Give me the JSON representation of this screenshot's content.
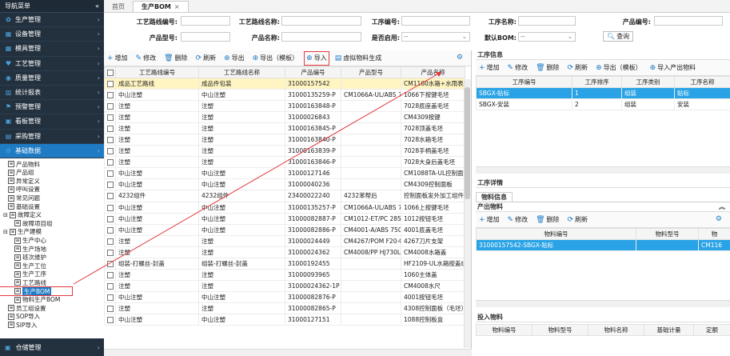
{
  "sidebar": {
    "title": "导航菜单",
    "collapse_icon": "«",
    "menus": [
      {
        "label": "生产管理",
        "icon": "gear-icon"
      },
      {
        "label": "设备管理",
        "icon": "grid-icon"
      },
      {
        "label": "模具管理",
        "icon": "grid-icon"
      },
      {
        "label": "工艺管理",
        "icon": "heart-icon"
      },
      {
        "label": "质量管理",
        "icon": "check-icon"
      },
      {
        "label": "统计报表",
        "icon": "chart-icon"
      },
      {
        "label": "预警管理",
        "icon": "alert-icon"
      },
      {
        "label": "看板管理",
        "icon": "board-icon"
      },
      {
        "label": "采购管理",
        "icon": "cart-icon"
      },
      {
        "label": "基础数据",
        "icon": "data-icon"
      }
    ],
    "tree": [
      {
        "label": "产品物料",
        "level": 1
      },
      {
        "label": "产品组",
        "level": 1
      },
      {
        "label": "异常定义",
        "level": 1
      },
      {
        "label": "呼叫设置",
        "level": 1
      },
      {
        "label": "常见问题",
        "level": 1
      },
      {
        "label": "基础设置",
        "level": 1
      },
      {
        "label": "故障定义",
        "level": 0,
        "toggle": "⊟"
      },
      {
        "label": "故障项目组",
        "level": 2
      },
      {
        "label": "生产建模",
        "level": 0,
        "toggle": "⊟"
      },
      {
        "label": "生产中心",
        "level": 2
      },
      {
        "label": "生产场地",
        "level": 2
      },
      {
        "label": "班次维护",
        "level": 2
      },
      {
        "label": "生产工位",
        "level": 2
      },
      {
        "label": "生产工序",
        "level": 2
      },
      {
        "label": "工艺路线",
        "level": 2
      },
      {
        "label": "生产BOM",
        "level": 2,
        "selected": true
      },
      {
        "label": "物料生产BOM",
        "level": 2
      },
      {
        "label": "员工组设置",
        "level": 1
      },
      {
        "label": "SOP导入",
        "level": 1
      },
      {
        "label": "SIP导入",
        "level": 1
      }
    ],
    "bottom": {
      "label": "仓储管理"
    }
  },
  "tabs": [
    {
      "label": "首页"
    },
    {
      "label": "生产BOM",
      "close": "×"
    }
  ],
  "filters": {
    "route_code": "工艺路线编号:",
    "route_name": "工艺路线名称:",
    "process_code": "工序编号:",
    "process_name": "工序名称:",
    "product_code": "产品编号:",
    "product_model": "产品型号:",
    "product_name": "产品名称:",
    "enabled": "是否启用:",
    "enabled_value": "--",
    "default_bom": "默认BOM:",
    "default_bom_value": "--",
    "query": "查询"
  },
  "toolbar": {
    "add": "增加",
    "edit": "修改",
    "delete": "删除",
    "refresh": "刷新",
    "export": "导出",
    "export_template": "导出（模板）",
    "import": "导入",
    "virtual": "虚拟物料生成"
  },
  "grid": {
    "headers": [
      "工艺路线编号",
      "工艺路线名称",
      "产品编号",
      "产品型号",
      "产品名称"
    ],
    "rows": [
      [
        "成品工艺路线",
        "成品件包装",
        "31000157542",
        "",
        "CM1160水箱+水雨表"
      ],
      [
        "中山注塑",
        "中山注塑",
        "31000135259-P",
        "CM1066A-UL/ABS 7",
        "1066下按键毛坯"
      ],
      [
        "注塑",
        "注塑",
        "31000163848-P",
        "",
        "7028底座盖毛坯"
      ],
      [
        "注塑",
        "注塑",
        "31000026843",
        "",
        "CM4309按键"
      ],
      [
        "注塑",
        "注塑",
        "31000163845-P",
        "",
        "7028顶盖毛坯"
      ],
      [
        "注塑",
        "注塑",
        "31000163840-P",
        "",
        "7028水箱毛坯"
      ],
      [
        "注塑",
        "注塑",
        "31000163839-P",
        "",
        "7028手柄盖毛坯"
      ],
      [
        "注塑",
        "注塑",
        "31000163846-P",
        "",
        "7028大身后盖毛坯"
      ],
      [
        "中山注塑",
        "中山注塑",
        "31000127146",
        "",
        "CM1088TA-UL控制面板"
      ],
      [
        "中山注塑",
        "中山注塑",
        "31000040236",
        "",
        "CM4309控制面板"
      ],
      [
        "4232组件",
        "4232组件",
        "23400022240",
        "4232苯帮后",
        "控制面板发外加工组件"
      ],
      [
        "中山注塑",
        "中山注塑",
        "31000135257-P",
        "CM1066A-UL/ABS 7",
        "1066上按键毛坯"
      ],
      [
        "中山注塑",
        "中山注塑",
        "31000082887-P",
        "CM1012-ET/PC 285(",
        "1012按钮毛坯"
      ],
      [
        "中山注塑",
        "中山注塑",
        "31000082886-P",
        "CM4001-A/ABS 750",
        "4001底盖毛坯"
      ],
      [
        "注塑",
        "注塑",
        "31000024449",
        "CM4267/POM F20-C",
        "4267刀片支架"
      ],
      [
        "注塑",
        "注塑",
        "31000024362",
        "CM4008/PP HJ730L",
        "CM4008水箱盖"
      ],
      [
        "组装-打螺丝-封盖",
        "组装-打螺丝-封盖",
        "31000192455",
        "",
        "HF2109-UL水箱按盖组件"
      ],
      [
        "注塑",
        "注塑",
        "31000093965",
        "",
        "1060主体盖"
      ],
      [
        "注塑",
        "注塑",
        "31000024362-1P",
        "",
        "CM4008水尺"
      ],
      [
        "中山注塑",
        "中山注塑",
        "31000082876-P",
        "",
        "4001按钮毛坯"
      ],
      [
        "注塑",
        "注塑",
        "31000082865-P",
        "",
        "4308控制面板（毛坯）"
      ],
      [
        "中山注塑",
        "中山注塑",
        "31000127151",
        "",
        "1088控制板盒"
      ]
    ]
  },
  "process_panel": {
    "title": "工序信息",
    "toolbar": {
      "add": "增加",
      "edit": "修改",
      "delete": "删除",
      "refresh": "刷新",
      "export_template": "导出（模板）",
      "import_output": "导入产出物料"
    },
    "headers": [
      "工序编号",
      "工序排序",
      "工序类别",
      "工序名称"
    ],
    "rows": [
      [
        "SBGX-贴标",
        "1",
        "组装",
        "贴标"
      ],
      [
        "SBGX-安装",
        "2",
        "组装",
        "安装"
      ]
    ]
  },
  "detail_panel": {
    "title": "工序详情",
    "subtab": "物料信息",
    "output_title": "产出物料",
    "toolbar": {
      "add": "增加",
      "edit": "修改",
      "delete": "删除",
      "refresh": "刷新"
    },
    "headers": [
      "物料编号",
      "物料型号",
      "物"
    ],
    "rows": [
      [
        "31000157542-SBGX-贴标",
        "",
        "CM116"
      ]
    ],
    "input_title": "投入物料",
    "input_headers": [
      "物料编号",
      "物料型号",
      "物料名称",
      "基础计量",
      "定额"
    ]
  },
  "colors": {
    "sidebar": "#23313f",
    "accent": "#1e7bc4",
    "highlight_row": "#fff5c2",
    "selected_row": "#29a3e6",
    "annotation": "#e4393c"
  }
}
